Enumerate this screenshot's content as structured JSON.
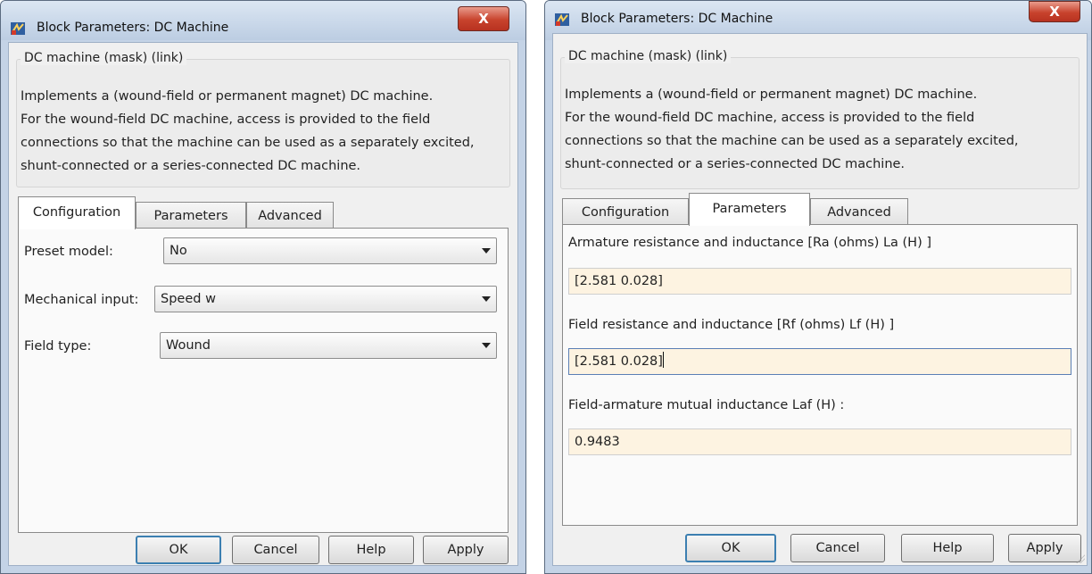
{
  "left_dialog": {
    "title": "Block Parameters: DC Machine",
    "close_label": "X",
    "group_title": "DC machine (mask) (link)",
    "description": [
      "Implements a (wound-field or permanent magnet) DC machine.",
      "For the wound-field DC machine, access is provided to the field",
      "connections so that the machine can be used as a separately excited,",
      "shunt-connected or a series-connected  DC machine."
    ],
    "tabs": [
      "Configuration",
      "Parameters",
      "Advanced"
    ],
    "active_tab": "Configuration",
    "fields": [
      {
        "label": "Preset  model:",
        "value": "No"
      },
      {
        "label": "Mechanical input:",
        "value": "Speed w"
      },
      {
        "label": "Field type:",
        "value": "Wound"
      }
    ],
    "buttons": {
      "ok": "OK",
      "cancel": "Cancel",
      "help": "Help",
      "apply": "Apply"
    }
  },
  "right_dialog": {
    "title": "Block Parameters: DC Machine",
    "close_label": "X",
    "group_title": "DC machine (mask) (link)",
    "description": [
      "Implements a (wound-field or permanent magnet) DC machine.",
      "For the wound-field DC machine, access is provided to the field",
      "connections so that the machine can be used as a separately excited,",
      "shunt-connected or a series-connected  DC machine."
    ],
    "tabs": [
      "Configuration",
      "Parameters",
      "Advanced"
    ],
    "active_tab": "Parameters",
    "params": [
      {
        "label": "Armature resistance and inductance [Ra (ohms) La (H) ]",
        "value": "[2.581 0.028]"
      },
      {
        "label": "Field resistance and inductance [Rf (ohms) Lf (H) ]",
        "value": "[2.581 0.028]"
      },
      {
        "label": "Field-armature mutual inductance Laf (H) :",
        "value": "0.9483"
      }
    ],
    "buttons": {
      "ok": "OK",
      "cancel": "Cancel",
      "help": "Help",
      "apply": "Apply"
    }
  },
  "colors": {
    "input_bg": "#fdf3e1",
    "close_red": "#c8432d",
    "default_button_border": "#3c7fb1"
  }
}
